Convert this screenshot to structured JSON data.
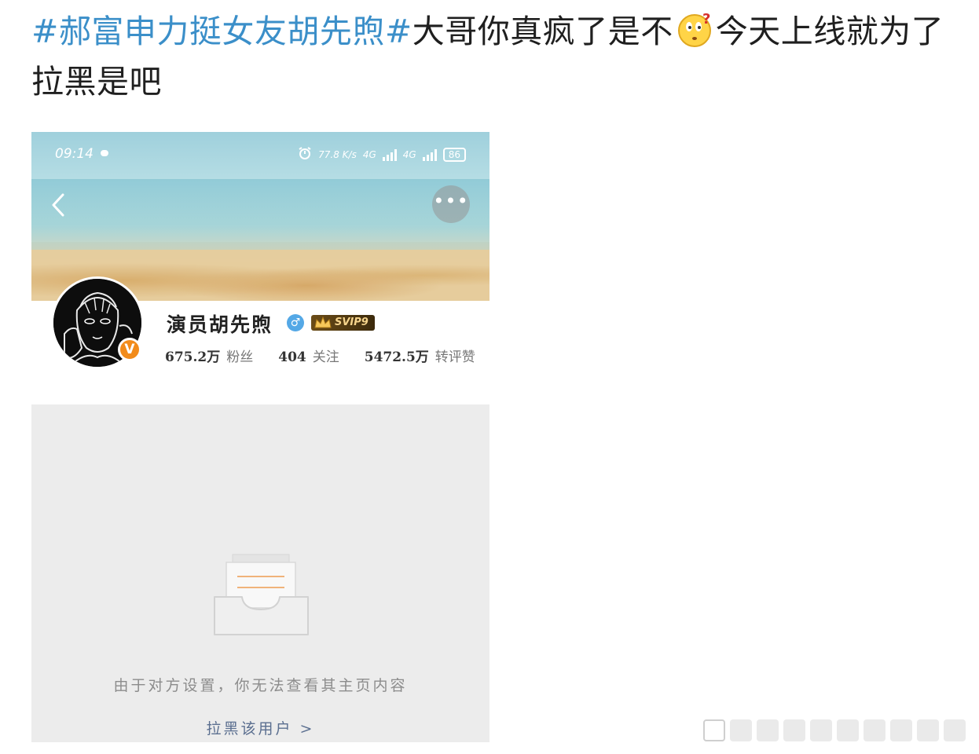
{
  "post": {
    "topic": "#郝富申力挺女友胡先煦#",
    "text_a": "大哥你真疯了是不",
    "text_b": "今天上线就为了拉黑是吧",
    "emoji": "confused-face-icon"
  },
  "screenshot": {
    "status": {
      "time": "09:14",
      "speed": "77.8 K/s",
      "network_a": "4G",
      "network_b": "4G",
      "battery": "86"
    },
    "profile": {
      "name": "演员胡先煦",
      "gender_symbol": "♂",
      "vip": "SVIP9",
      "verified_letter": "V",
      "stats": [
        {
          "num": "675.2万",
          "label": "粉丝"
        },
        {
          "num": "404",
          "label": "关注"
        },
        {
          "num": "5472.5万",
          "label": "转评赞"
        }
      ]
    },
    "empty_message": "由于对方设置，你无法查看其主页内容",
    "block_link": "拉黑该用户 >"
  },
  "colors": {
    "topic": "#3b8fc9",
    "vip_gold": "#f6d48c",
    "verified_orange": "#f28b1a",
    "link_blue": "#5b6f90"
  }
}
